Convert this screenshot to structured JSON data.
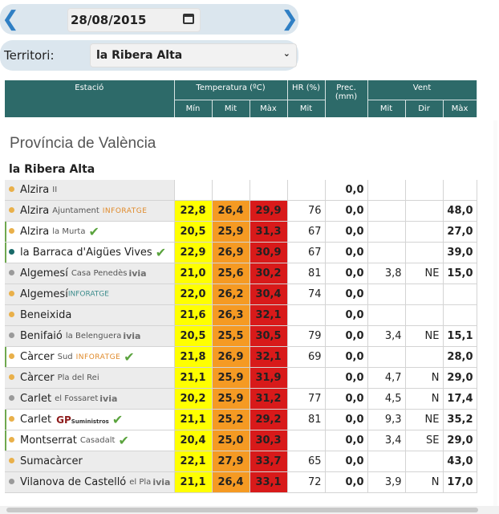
{
  "date": "28/08/2015",
  "territory": {
    "label": "Territori:",
    "selected": "la Ribera Alta"
  },
  "headers": {
    "station": "Estació",
    "temperature": "Temperatura (ºC)",
    "hr": "HR (%)",
    "prec": "Prec. (mm)",
    "wind": "Vent",
    "min": "Mín",
    "mit": "Mit",
    "max": "Màx",
    "dir": "Dir"
  },
  "province": "Província de València",
  "region": "la Ribera Alta",
  "colors": {
    "header": "#2d6a69",
    "tmin": "#ffff00",
    "tmit": "#f59a23",
    "tmax": "#d81a1a",
    "dot_orange": "#e9b04a",
    "dot_grey": "#9a9a9a",
    "dot_teal": "#1a6a69",
    "check": "#5aa33d"
  },
  "rows": [
    {
      "name": "Alzira",
      "sub": "II",
      "dot": "orange",
      "mark": false,
      "tmin": "",
      "tmit": "",
      "tmax": "",
      "hr": "",
      "prec": "0,0",
      "wmit": "",
      "wdir": "",
      "wmax": ""
    },
    {
      "name": "Alzira",
      "sub": "Ajuntament",
      "brand": "INFORATGE",
      "dot": "orange",
      "mark": false,
      "tmin": "22,8",
      "tmit": "26,4",
      "tmax": "29,9",
      "hr": "76",
      "prec": "0,0",
      "wmit": "",
      "wdir": "",
      "wmax": "48,0"
    },
    {
      "name": "Alzira",
      "sub": "la Murta",
      "check": "✔",
      "dot": "orange",
      "mark": true,
      "tmin": "20,5",
      "tmit": "25,9",
      "tmax": "31,3",
      "hr": "67",
      "prec": "0,0",
      "wmit": "",
      "wdir": "",
      "wmax": "27,0"
    },
    {
      "name": "la Barraca d'Aigües Vives",
      "check": "✔",
      "dot": "teal",
      "mark": true,
      "tmin": "22,9",
      "tmit": "26,9",
      "tmax": "30,9",
      "hr": "67",
      "prec": "0,0",
      "wmit": "",
      "wdir": "",
      "wmax": "39,0"
    },
    {
      "name": "Algemesí",
      "sub": "Casa Penedès",
      "ivia": "ivia",
      "dot": "grey",
      "mark": false,
      "tmin": "21,0",
      "tmit": "25,6",
      "tmax": "30,2",
      "hr": "81",
      "prec": "0,0",
      "wmit": "3,8",
      "wdir": "NE",
      "wmax": "15,0"
    },
    {
      "name": "Algemesí",
      "brand2": "INFORATGE",
      "dot": "orange",
      "mark": false,
      "tmin": "22,0",
      "tmit": "26,2",
      "tmax": "30,4",
      "hr": "74",
      "prec": "0,0",
      "wmit": "",
      "wdir": "",
      "wmax": ""
    },
    {
      "name": "Beneixida",
      "dot": "orange",
      "mark": false,
      "tmin": "21,6",
      "tmit": "26,3",
      "tmax": "32,1",
      "hr": "",
      "prec": "0,0",
      "wmit": "",
      "wdir": "",
      "wmax": ""
    },
    {
      "name": "Benifaió",
      "sub": "la Belenguera",
      "ivia": "ivia",
      "dot": "grey",
      "mark": false,
      "tmin": "20,5",
      "tmit": "25,5",
      "tmax": "30,5",
      "hr": "79",
      "prec": "0,0",
      "wmit": "3,4",
      "wdir": "NE",
      "wmax": "15,1"
    },
    {
      "name": "Càrcer",
      "sub": "Sud",
      "brand": "INFORATGE",
      "check": "✔",
      "dot": "orange",
      "mark": true,
      "tmin": "21,8",
      "tmit": "26,9",
      "tmax": "32,1",
      "hr": "69",
      "prec": "0,0",
      "wmit": "",
      "wdir": "",
      "wmax": "28,0"
    },
    {
      "name": "Càrcer",
      "sub": "Pla del Rei",
      "dot": "orange",
      "mark": false,
      "tmin": "21,1",
      "tmit": "25,9",
      "tmax": "31,9",
      "hr": "",
      "prec": "0,0",
      "wmit": "4,7",
      "wdir": "N",
      "wmax": "29,0"
    },
    {
      "name": "Carlet",
      "sub": "el Fossaret",
      "ivia": "ivia",
      "dot": "grey",
      "mark": false,
      "tmin": "20,2",
      "tmit": "25,9",
      "tmax": "31,2",
      "hr": "77",
      "prec": "0,0",
      "wmit": "4,5",
      "wdir": "N",
      "wmax": "17,4"
    },
    {
      "name": "Carlet",
      "gp": "GP",
      "gpsub": "Suministros",
      "check": "✔",
      "dot": "orange",
      "mark": true,
      "tmin": "21,1",
      "tmit": "25,2",
      "tmax": "29,2",
      "hr": "81",
      "prec": "0,0",
      "wmit": "9,3",
      "wdir": "NE",
      "wmax": "35,2"
    },
    {
      "name": "Montserrat",
      "sub": "Casadalt",
      "check": "✔",
      "dot": "orange",
      "mark": true,
      "tmin": "20,4",
      "tmit": "25,0",
      "tmax": "30,3",
      "hr": "",
      "prec": "0,0",
      "wmit": "3,4",
      "wdir": "SE",
      "wmax": "29,0"
    },
    {
      "name": "Sumacàrcer",
      "dot": "orange",
      "mark": false,
      "tmin": "22,1",
      "tmit": "27,9",
      "tmax": "33,7",
      "hr": "65",
      "prec": "0,0",
      "wmit": "",
      "wdir": "",
      "wmax": "43,0"
    },
    {
      "name": "Vilanova de Castelló",
      "sub": "el Pla",
      "ivia": "ivia",
      "dot": "grey",
      "mark": false,
      "tmin": "21,1",
      "tmit": "26,4",
      "tmax": "33,1",
      "hr": "72",
      "prec": "0,0",
      "wmit": "3,9",
      "wdir": "N",
      "wmax": "17,0"
    }
  ]
}
